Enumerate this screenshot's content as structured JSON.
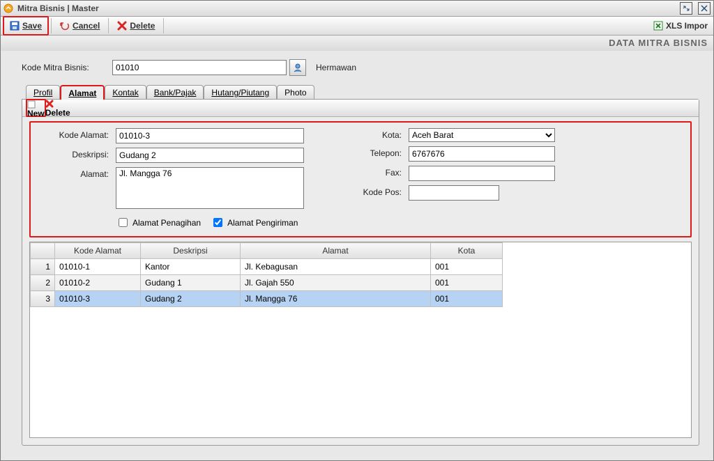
{
  "window": {
    "title": "Mitra Bisnis | Master"
  },
  "toolbar": {
    "save": "Save",
    "cancel": "Cancel",
    "delete": "Delete",
    "xls_impor": "XLS Impor"
  },
  "section_header": "DATA MITRA BISNIS",
  "header": {
    "kode_label": "Kode Mitra Bisnis:",
    "kode_value": "01010",
    "name": "Hermawan"
  },
  "tabs": [
    "Profil",
    "Alamat",
    "Kontak",
    "Bank/Pajak",
    "Hutang/Piutang",
    "Photo"
  ],
  "inner_toolbar": {
    "new": "New",
    "delete": "Delete"
  },
  "form": {
    "labels": {
      "kode_alamat": "Kode Alamat:",
      "deskripsi": "Deskripsi:",
      "alamat": "Alamat:",
      "kota": "Kota:",
      "telepon": "Telepon:",
      "fax": "Fax:",
      "kode_pos": "Kode Pos:",
      "alamat_penagihan": "Alamat Penagihan",
      "alamat_pengiriman": "Alamat Pengiriman"
    },
    "values": {
      "kode_alamat": "01010-3",
      "deskripsi": "Gudang 2",
      "alamat": "Jl. Mangga 76",
      "kota": "Aceh Barat",
      "telepon": "6767676",
      "fax": "",
      "kode_pos": ""
    },
    "checks": {
      "penagihan": false,
      "pengiriman": true
    }
  },
  "table": {
    "headers": [
      "Kode Alamat",
      "Deskripsi",
      "Alamat",
      "Kota"
    ],
    "rows": [
      {
        "n": "1",
        "kode": "01010-1",
        "desk": "Kantor",
        "alamat": "Jl. Kebagusan",
        "kota": "001"
      },
      {
        "n": "2",
        "kode": "01010-2",
        "desk": "Gudang 1",
        "alamat": "Jl. Gajah 550",
        "kota": "001"
      },
      {
        "n": "3",
        "kode": "01010-3",
        "desk": "Gudang 2",
        "alamat": "Jl. Mangga 76",
        "kota": "001"
      }
    ],
    "selected_index": 2
  }
}
